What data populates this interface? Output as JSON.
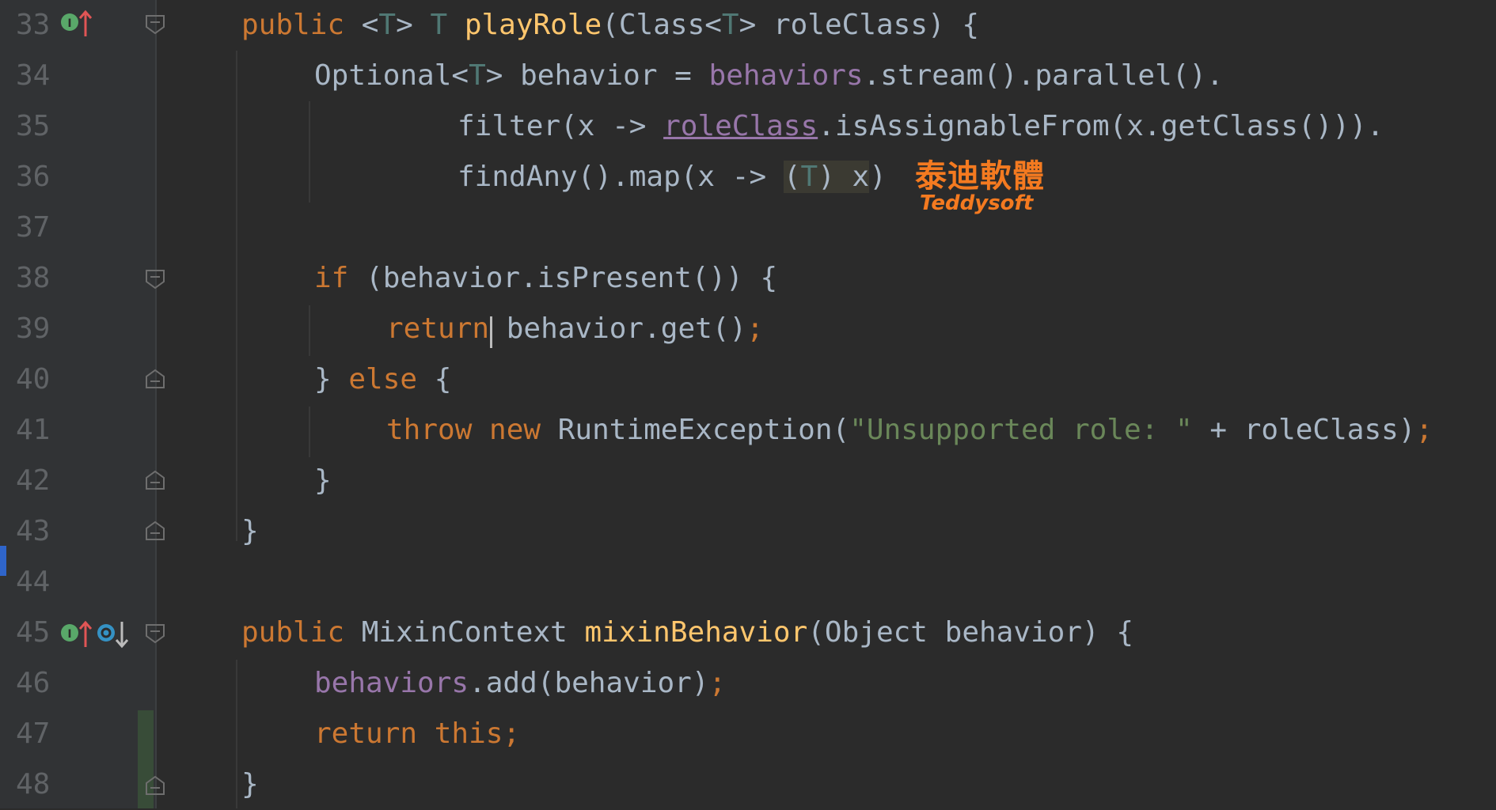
{
  "editor": {
    "lines": [
      {
        "num": "33",
        "segments": [
          {
            "t": "public ",
            "c": "kw"
          },
          {
            "t": "<",
            "c": ""
          },
          {
            "t": "T",
            "c": "tp"
          },
          {
            "t": "> ",
            "c": ""
          },
          {
            "t": "T ",
            "c": "tp"
          },
          {
            "t": "playRole",
            "c": "fn"
          },
          {
            "t": "(Class<",
            "c": ""
          },
          {
            "t": "T",
            "c": "tp"
          },
          {
            "t": "> roleClass) {",
            "c": ""
          }
        ]
      },
      {
        "num": "34",
        "segments": [
          {
            "t": "Optional<",
            "c": ""
          },
          {
            "t": "T",
            "c": "tp"
          },
          {
            "t": "> behavior = ",
            "c": ""
          },
          {
            "t": "behaviors",
            "c": "fld"
          },
          {
            "t": ".stream().parallel().",
            "c": ""
          }
        ]
      },
      {
        "num": "35",
        "segments": [
          {
            "t": "filter(x -> ",
            "c": ""
          },
          {
            "t": "roleClass",
            "c": "fld ul"
          },
          {
            "t": ".isAssignableFrom(x.getClass())).",
            "c": ""
          }
        ]
      },
      {
        "num": "36",
        "segments": [
          {
            "t": "findAny().map(x -> ",
            "c": ""
          },
          {
            "t": "(",
            "c": "hl"
          },
          {
            "t": "T",
            "c": "tp hl"
          },
          {
            "t": ") x",
            "c": "hl"
          },
          {
            "t": ")",
            "c": ""
          }
        ]
      },
      {
        "num": "37",
        "segments": []
      },
      {
        "num": "38",
        "segments": [
          {
            "t": "if ",
            "c": "kw"
          },
          {
            "t": "(behavior.isPresent()) {",
            "c": ""
          }
        ]
      },
      {
        "num": "39",
        "segments": [
          {
            "t": "return ",
            "c": "kw"
          },
          {
            "t": "behavior.get()",
            "c": ""
          },
          {
            "t": ";",
            "c": "kw"
          }
        ]
      },
      {
        "num": "40",
        "segments": [
          {
            "t": "} ",
            "c": ""
          },
          {
            "t": "else ",
            "c": "kw"
          },
          {
            "t": "{",
            "c": ""
          }
        ]
      },
      {
        "num": "41",
        "segments": [
          {
            "t": "throw new ",
            "c": "kw"
          },
          {
            "t": "RuntimeException(",
            "c": ""
          },
          {
            "t": "\"Unsupported role: \"",
            "c": "str"
          },
          {
            "t": " + roleClass)",
            "c": ""
          },
          {
            "t": ";",
            "c": "kw"
          }
        ]
      },
      {
        "num": "42",
        "segments": [
          {
            "t": "}",
            "c": ""
          }
        ]
      },
      {
        "num": "43",
        "segments": [
          {
            "t": "}",
            "c": ""
          }
        ]
      },
      {
        "num": "44",
        "segments": []
      },
      {
        "num": "45",
        "segments": [
          {
            "t": "public ",
            "c": "kw"
          },
          {
            "t": "MixinContext ",
            "c": ""
          },
          {
            "t": "mixinBehavior",
            "c": "fn"
          },
          {
            "t": "(Object behavior) {",
            "c": ""
          }
        ]
      },
      {
        "num": "46",
        "segments": [
          {
            "t": "behaviors",
            "c": "fld"
          },
          {
            "t": ".add(behavior)",
            "c": ""
          },
          {
            "t": ";",
            "c": "kw"
          }
        ]
      },
      {
        "num": "47",
        "segments": [
          {
            "t": "return this;",
            "c": "kw"
          }
        ]
      },
      {
        "num": "48",
        "segments": [
          {
            "t": "}",
            "c": ""
          }
        ]
      }
    ]
  },
  "watermark": {
    "chinese": "泰迪軟體",
    "english": "Teddysoft"
  },
  "colors": {
    "background": "#2b2b2b",
    "keyword": "#cc7832",
    "method": "#ffc66d",
    "type_param": "#507874",
    "field": "#9876aa",
    "string": "#6a8759",
    "text": "#a9b7c6",
    "line_number": "#606366",
    "watermark": "#f47a20"
  },
  "gutter_icons": {
    "line33": [
      "implemented-up-arrow-icon"
    ],
    "line45": [
      "implemented-up-arrow-icon",
      "overridden-down-arrow-icon"
    ]
  }
}
